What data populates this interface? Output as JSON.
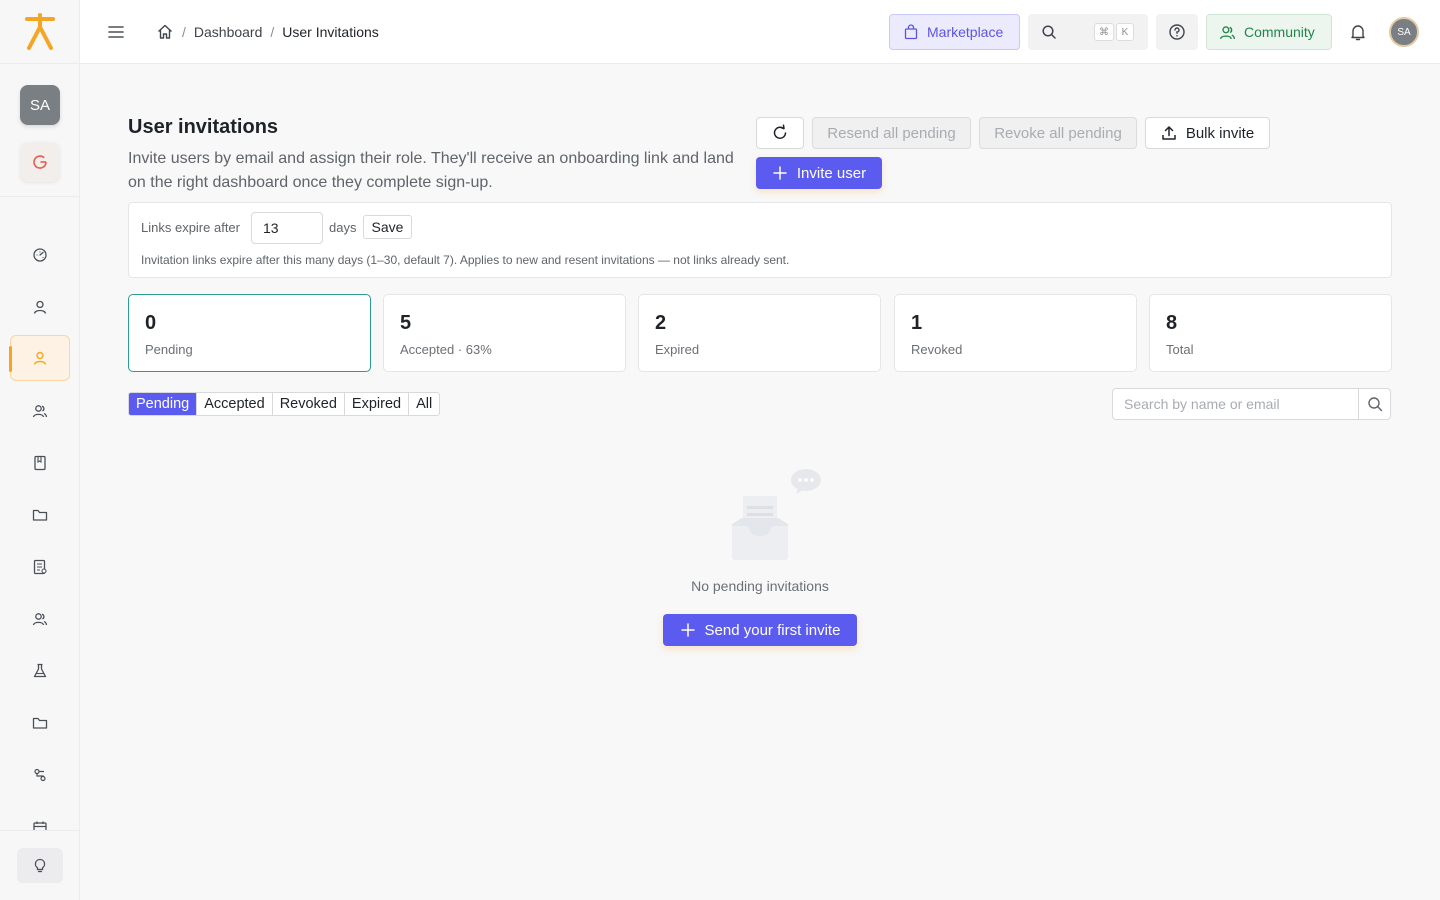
{
  "sidebar": {
    "avatar_initials": "SA",
    "nav": [
      {
        "icon": "dashboard-icon"
      },
      {
        "icon": "user-icon"
      },
      {
        "icon": "user-invite-icon",
        "active": true
      },
      {
        "icon": "users-icon"
      },
      {
        "icon": "book-icon"
      },
      {
        "icon": "folder-icon"
      },
      {
        "icon": "report-icon"
      },
      {
        "icon": "team-icon"
      },
      {
        "icon": "flask-icon"
      },
      {
        "icon": "folder-icon"
      },
      {
        "icon": "workflow-icon"
      },
      {
        "icon": "calendar-icon"
      }
    ],
    "footer_icon": "lightbulb-icon"
  },
  "topbar": {
    "breadcrumb": [
      "Dashboard",
      "User Invitations"
    ],
    "marketplace_label": "Marketplace",
    "shortcut_keys": [
      "⌘",
      "K"
    ],
    "community_label": "Community",
    "avatar_initials": "SA"
  },
  "header": {
    "title": "User invitations",
    "description": "Invite users by email and assign their role. They'll receive an onboarding link and land on the right dashboard once they complete sign-up.",
    "resend_all_label": "Resend all pending",
    "revoke_all_label": "Revoke all pending",
    "bulk_invite_label": "Bulk invite",
    "invite_user_label": "Invite user"
  },
  "expiry": {
    "label": "Links expire after",
    "value": "13",
    "unit": "days",
    "save_label": "Save",
    "note": "Invitation links expire after this many days (1–30, default 7). Applies to new and resent invitations — not links already sent."
  },
  "stats": [
    {
      "value": "0",
      "label": "Pending",
      "selected": true
    },
    {
      "value": "5",
      "label": "Accepted · 63%"
    },
    {
      "value": "2",
      "label": "Expired"
    },
    {
      "value": "1",
      "label": "Revoked"
    },
    {
      "value": "8",
      "label": "Total"
    }
  ],
  "filters": {
    "tabs": [
      "Pending",
      "Accepted",
      "Revoked",
      "Expired",
      "All"
    ],
    "active": "Pending",
    "search_placeholder": "Search by name or email"
  },
  "empty_state": {
    "message": "No pending invitations",
    "cta_label": "Send your first invite"
  },
  "colors": {
    "accent": "#5b5bf0",
    "brand_orange": "#f5a524",
    "community_green": "#22864a",
    "selected_card_border": "#2a9d8f"
  }
}
